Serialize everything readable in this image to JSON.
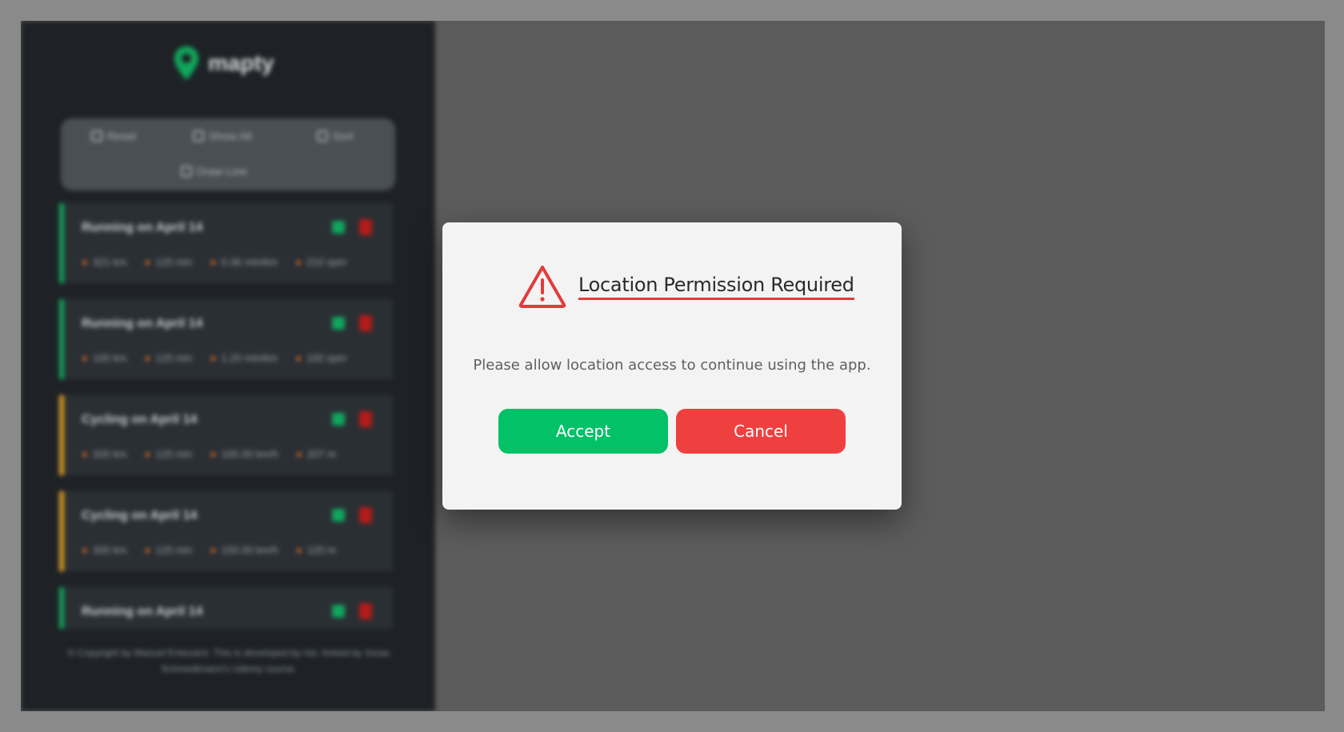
{
  "app": {
    "logo_text": "mapty"
  },
  "sidebar": {
    "controls": [
      "Reset",
      "Show All",
      "Sort",
      "Draw Line"
    ],
    "workouts": [
      {
        "type": "running",
        "title": "Running on April 14",
        "stats": [
          "321 km",
          "120 min",
          "0.36 min/km",
          "210 spm"
        ]
      },
      {
        "type": "running",
        "title": "Running on April 14",
        "stats": [
          "100 km",
          "120 min",
          "1.20 min/km",
          "100 spm"
        ]
      },
      {
        "type": "cycling",
        "title": "Cycling on April 14",
        "stats": [
          "200 km",
          "120 min",
          "100.00 km/h",
          "207 m"
        ]
      },
      {
        "type": "cycling",
        "title": "Cycling on April 14",
        "stats": [
          "300 km",
          "120 min",
          "150.00 km/h",
          "120 m"
        ]
      },
      {
        "type": "running",
        "title": "Running on April 14",
        "stats": [
          "",
          "",
          "",
          ""
        ]
      }
    ],
    "footer": "© Copyright by Manuel Entezami. This is developed by me, forked by Jonas Schmedtmann's Udemy course."
  },
  "modal": {
    "title": "Location Permission Required",
    "message": "Please allow location access to continue using the app.",
    "accept_label": "Accept",
    "cancel_label": "Cancel",
    "warning_icon": "warning-triangle-icon",
    "colors": {
      "accept": "#03c167",
      "cancel": "#ef4040",
      "warning": "#e33b3b"
    }
  }
}
